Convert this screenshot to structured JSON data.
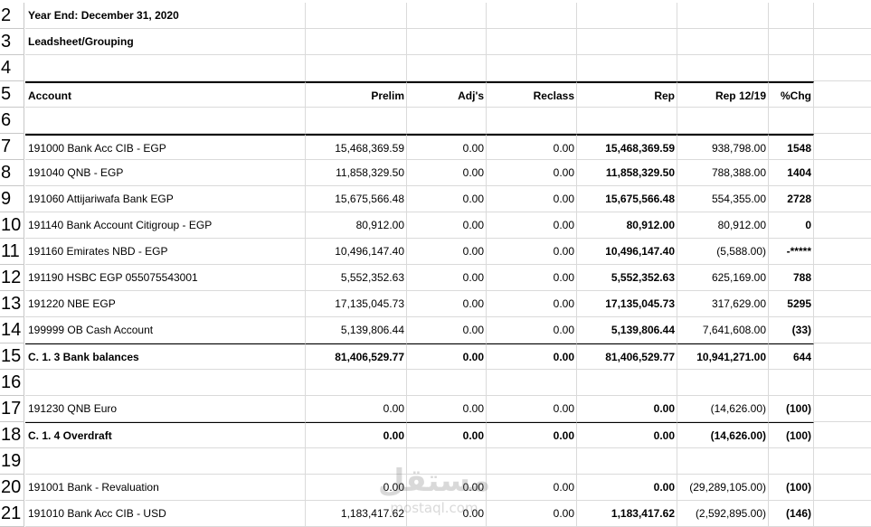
{
  "rows": [
    {
      "n": "2",
      "a": "Year End: December 31, 2020",
      "b": "",
      "c": "",
      "d": "",
      "e": "",
      "f": "",
      "g": "",
      "bold": true,
      "hdr": true
    },
    {
      "n": "3",
      "a": "Leadsheet/Grouping",
      "b": "",
      "c": "",
      "d": "",
      "e": "",
      "f": "",
      "g": "",
      "bold": true,
      "hdr": true
    },
    {
      "n": "4",
      "a": "",
      "b": "",
      "c": "",
      "d": "",
      "e": "",
      "f": "",
      "g": ""
    },
    {
      "n": "5",
      "a": "Account",
      "b": "Prelim",
      "c": "Adj's",
      "d": "Reclass",
      "e": "Rep",
      "f": "Rep 12/19",
      "g": "%Chg",
      "bold": true,
      "thick": true
    },
    {
      "n": "6",
      "a": "",
      "b": "",
      "c": "",
      "d": "",
      "e": "",
      "f": "",
      "g": ""
    },
    {
      "n": "7",
      "a": "191000 Bank Acc CIB - EGP",
      "b": "15,468,369.59",
      "c": "0.00",
      "d": "0.00",
      "e": "15,468,369.59",
      "f": "938,798.00",
      "g": "1548",
      "thick": true
    },
    {
      "n": "8",
      "a": "191040 QNB - EGP",
      "b": "11,858,329.50",
      "c": "0.00",
      "d": "0.00",
      "e": "11,858,329.50",
      "f": "788,388.00",
      "g": "1404"
    },
    {
      "n": "9",
      "a": "191060 Attijariwafa Bank EGP",
      "b": "15,675,566.48",
      "c": "0.00",
      "d": "0.00",
      "e": "15,675,566.48",
      "f": "554,355.00",
      "g": "2728"
    },
    {
      "n": "10",
      "a": "191140 Bank Account Citigroup - EGP",
      "b": "80,912.00",
      "c": "0.00",
      "d": "0.00",
      "e": "80,912.00",
      "f": "80,912.00",
      "g": "0"
    },
    {
      "n": "11",
      "a": "191160 Emirates NBD - EGP",
      "b": "10,496,147.40",
      "c": "0.00",
      "d": "0.00",
      "e": "10,496,147.40",
      "f": "(5,588.00)",
      "g": "-*****"
    },
    {
      "n": "12",
      "a": "191190 HSBC EGP 055075543001",
      "b": "5,552,352.63",
      "c": "0.00",
      "d": "0.00",
      "e": "5,552,352.63",
      "f": "625,169.00",
      "g": "788"
    },
    {
      "n": "13",
      "a": "191220 NBE EGP",
      "b": "17,135,045.73",
      "c": "0.00",
      "d": "0.00",
      "e": "17,135,045.73",
      "f": "317,629.00",
      "g": "5295"
    },
    {
      "n": "14",
      "a": "199999 OB Cash Account",
      "b": "5,139,806.44",
      "c": "0.00",
      "d": "0.00",
      "e": "5,139,806.44",
      "f": "7,641,608.00",
      "g": "(33)"
    },
    {
      "n": "15",
      "a": "C. 1.  3   Bank balances",
      "b": "81,406,529.77",
      "c": "0.00",
      "d": "0.00",
      "e": "81,406,529.77",
      "f": "10,941,271.00",
      "g": "644",
      "bold": true,
      "total": true
    },
    {
      "n": "16",
      "a": "",
      "b": "",
      "c": "",
      "d": "",
      "e": "",
      "f": "",
      "g": ""
    },
    {
      "n": "17",
      "a": "191230 QNB Euro",
      "b": "0.00",
      "c": "0.00",
      "d": "0.00",
      "e": "0.00",
      "f": "(14,626.00)",
      "g": "(100)"
    },
    {
      "n": "18",
      "a": "C. 1.  4   Overdraft",
      "b": "0.00",
      "c": "0.00",
      "d": "0.00",
      "e": "0.00",
      "f": "(14,626.00)",
      "g": "(100)",
      "bold": true,
      "total": true
    },
    {
      "n": "19",
      "a": "",
      "b": "",
      "c": "",
      "d": "",
      "e": "",
      "f": "",
      "g": ""
    },
    {
      "n": "20",
      "a": "191001 Bank - Revaluation",
      "b": "0.00",
      "c": "0.00",
      "d": "0.00",
      "e": "0.00",
      "f": "(29,289,105.00)",
      "g": "(100)"
    },
    {
      "n": "21",
      "a": "191010 Bank Acc CIB - USD",
      "b": "1,183,417.62",
      "c": "0.00",
      "d": "0.00",
      "e": "1,183,417.62",
      "f": "(2,592,895.00)",
      "g": "(146)"
    }
  ],
  "watermark": {
    "arabic": "مستقل",
    "latin": "mostaql.com"
  }
}
